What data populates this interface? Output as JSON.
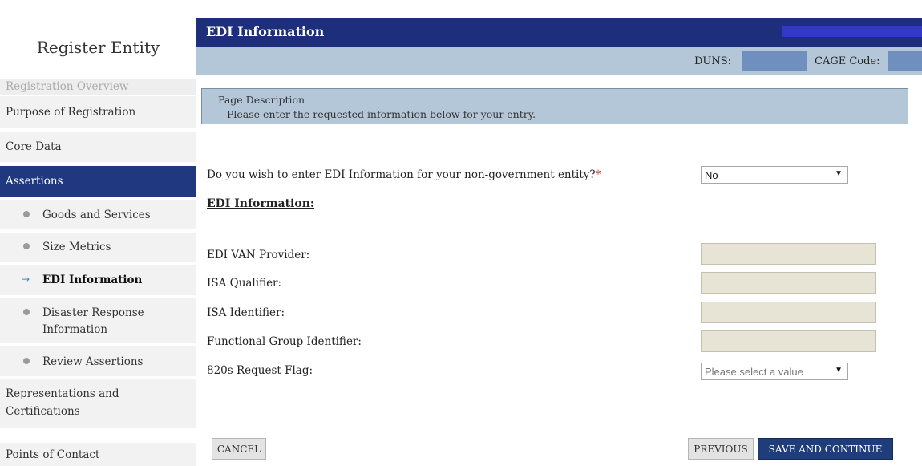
{
  "sidebar": {
    "title": "Register Entity",
    "nav": {
      "registration_overview": "Registration Overview",
      "purpose": "Purpose of Registration",
      "core_data": "Core Data",
      "assertions": "Assertions",
      "assertions_sub": {
        "goods": "Goods and Services",
        "size": "Size Metrics",
        "edi": "EDI Information",
        "disaster_line1": "Disaster Response",
        "disaster_line2": "Information",
        "review": "Review Assertions"
      },
      "reps_line1": "Representations and",
      "reps_line2": "Certifications",
      "poc": "Points of Contact"
    }
  },
  "header": {
    "title": "EDI Information",
    "duns_label": "DUNS:",
    "cage_label": "CAGE Code:"
  },
  "page_description": {
    "title": "Page Description",
    "text": "Please enter the requested information below for your entry."
  },
  "form": {
    "question": "Do you wish to enter EDI Information for your non-government entity?",
    "required_mark": "*",
    "question_value": "No",
    "section_heading": "EDI Information:",
    "edi_van_label": "EDI VAN Provider:",
    "isa_qualifier_label": "ISA Qualifier:",
    "isa_identifier_label": "ISA Identifier:",
    "functional_group_label": "Functional Group Identifier:",
    "flag_820_label": "820s Request Flag:",
    "flag_820_value": "Please select a value"
  },
  "buttons": {
    "cancel": "CANCEL",
    "previous": "PREVIOUS",
    "save_continue": "SAVE AND CONTINUE"
  },
  "colors": {
    "header_navy": "#1d2f7a",
    "active_nav": "#203880",
    "light_blue": "#b4c7d9",
    "accent_arrow": "#3a8ad6",
    "required": "#d12a2a"
  },
  "icons": {
    "select_caret": "▼",
    "current_arrow": "→"
  }
}
